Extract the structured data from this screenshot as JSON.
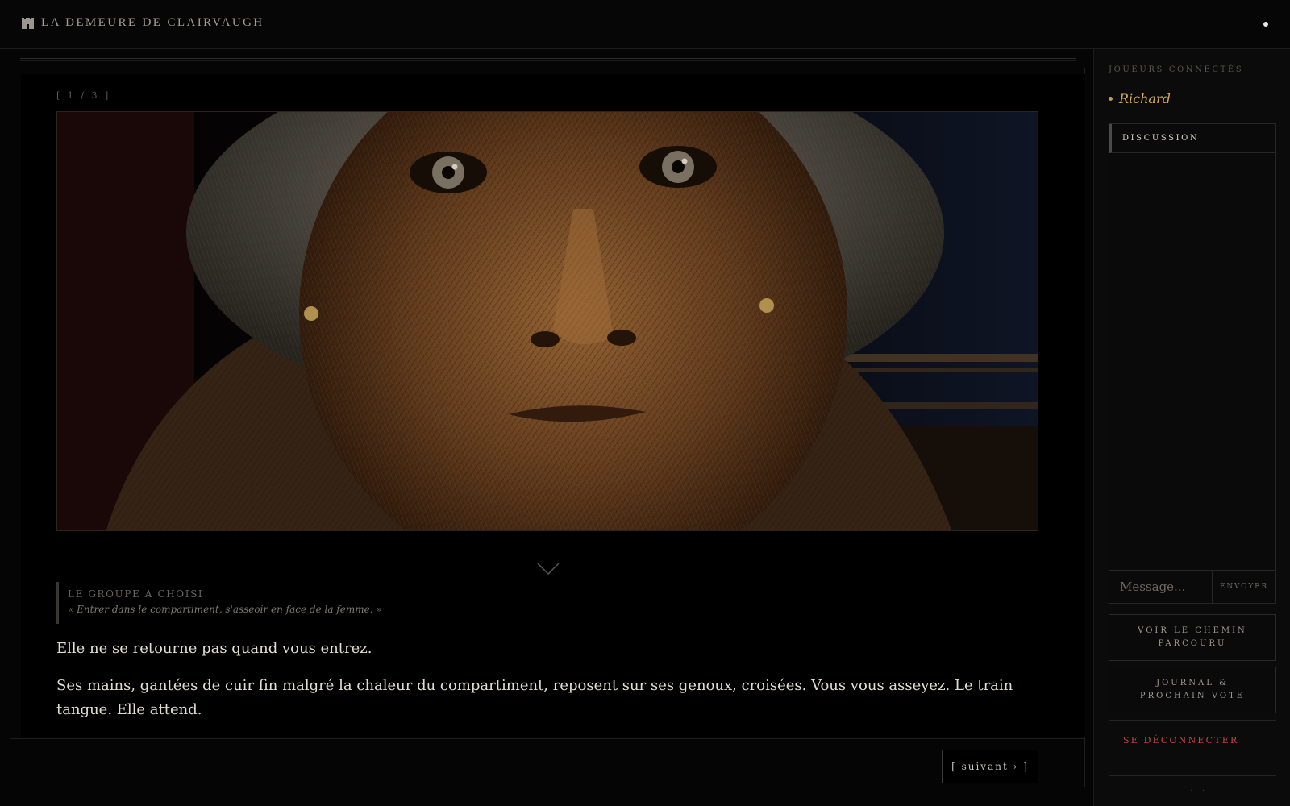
{
  "header": {
    "title": "LA DEMEURE DE CLAIRVAUGH",
    "icon": "castle-icon"
  },
  "story": {
    "counter": "[ 1 / 3 ]",
    "image_icon": "old-woman-portrait",
    "choice_label": "LE GROUPE A CHOISI",
    "choice_text": "« Entrer dans le compartiment, s'asseoir en face de la femme. »",
    "paragraphs": [
      "Elle ne se retourne pas quand vous entrez.",
      "Ses mains, gantées de cuir fin malgré la chaleur du compartiment, reposent sur ses genoux, croisées. Vous vous asseyez. Le train tangue. Elle attend."
    ],
    "next_label": "[ suivant › ]"
  },
  "sidebar": {
    "players_title": "JOUEURS CONNECTÉS",
    "players": [
      "Richard"
    ],
    "chat": {
      "title": "DISCUSSION",
      "placeholder": "Message...",
      "send_label": "ENVOYER"
    },
    "path_button": "VOIR LE CHEMIN PARCOURU",
    "journal_button": "JOURNAL & PROCHAIN VOTE",
    "logout_label": "SE DÉCONNECTER",
    "footer": "· · ·"
  },
  "colors": {
    "accent_gold": "#d7a863",
    "logout_red": "#c44343",
    "background": "#050505"
  }
}
